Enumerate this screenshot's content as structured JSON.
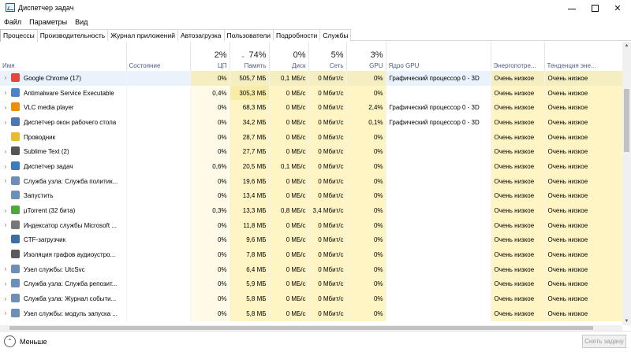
{
  "window": {
    "title": "Диспетчер задач",
    "minimize": "—",
    "maximize": "☐",
    "close": "✕"
  },
  "menu": [
    {
      "label": "Файл"
    },
    {
      "label": "Параметры"
    },
    {
      "label": "Вид"
    }
  ],
  "tabs": [
    {
      "label": "Процессы",
      "active": true
    },
    {
      "label": "Производительность"
    },
    {
      "label": "Журнал приложений"
    },
    {
      "label": "Автозагрузка"
    },
    {
      "label": "Пользователи"
    },
    {
      "label": "Подробности"
    },
    {
      "label": "Службы"
    }
  ],
  "columns": {
    "name": "Имя",
    "status": "Состояние",
    "cpu": {
      "pct": "2%",
      "label": "ЦП"
    },
    "memory": {
      "pct": "74%",
      "label": "Память"
    },
    "disk": {
      "pct": "0%",
      "label": "Диск"
    },
    "network": {
      "pct": "5%",
      "label": "Сеть"
    },
    "gpu": {
      "pct": "3%",
      "label": "GPU"
    },
    "gpu_engine": "Ядро GPU",
    "power": "Энергопотре...",
    "power_trend": "Тенденция эне..."
  },
  "processes": [
    {
      "name": "Google Chrome (17)",
      "icon": "chrome-icon",
      "color": "#e8453c",
      "cpu": "0%",
      "mem": "505,7 МБ",
      "disk": "0,1 МБ/с",
      "net": "0 Мбит/с",
      "gpu": "0%",
      "gpu_engine": "Графический процессор 0 - 3D",
      "power": "Очень низкое",
      "trend": "Очень низкое"
    },
    {
      "name": "Antimalware Service Executable",
      "icon": "shield-icon",
      "color": "#4f83c7",
      "cpu": "0,4%",
      "mem": "305,3 МБ",
      "disk": "0 МБ/с",
      "net": "0 Мбит/с",
      "gpu": "0%",
      "gpu_engine": "",
      "power": "Очень низкое",
      "trend": "Очень низкое"
    },
    {
      "name": "VLC media player",
      "icon": "vlc-icon",
      "color": "#f08c00",
      "cpu": "0%",
      "mem": "68,3 МБ",
      "disk": "0 МБ/с",
      "net": "0 Мбит/с",
      "gpu": "2,4%",
      "gpu_engine": "Графический процессор 0 - 3D",
      "power": "Очень низкое",
      "trend": "Очень низкое"
    },
    {
      "name": "Диспетчер окон рабочего стола",
      "icon": "dwm-icon",
      "color": "#4a78b5",
      "cpu": "0%",
      "mem": "34,2 МБ",
      "disk": "0 МБ/с",
      "net": "0 Мбит/с",
      "gpu": "0,1%",
      "gpu_engine": "Графический процессор 0 - 3D",
      "power": "Очень низкое",
      "trend": "Очень низкое"
    },
    {
      "name": "Проводник",
      "icon": "folder-icon",
      "color": "#e8b931",
      "cpu": "0%",
      "mem": "28,7 МБ",
      "disk": "0 МБ/с",
      "net": "0 Мбит/с",
      "gpu": "0%",
      "gpu_engine": "",
      "power": "Очень низкое",
      "trend": "Очень низкое"
    },
    {
      "name": "Sublime Text (2)",
      "icon": "sublime-icon",
      "color": "#555555",
      "cpu": "0%",
      "mem": "27,7 МБ",
      "disk": "0 МБ/с",
      "net": "0 Мбит/с",
      "gpu": "0%",
      "gpu_engine": "",
      "power": "Очень низкое",
      "trend": "Очень низкое"
    },
    {
      "name": "Диспетчер задач",
      "icon": "taskmgr-icon",
      "color": "#3b7bbf",
      "cpu": "0,6%",
      "mem": "20,5 МБ",
      "disk": "0,1 МБ/с",
      "net": "0 Мбит/с",
      "gpu": "0%",
      "gpu_engine": "",
      "power": "Очень низкое",
      "trend": "Очень низкое"
    },
    {
      "name": "Служба узла: Служба политик...",
      "icon": "gear-icon",
      "color": "#6b8fb8",
      "cpu": "0%",
      "mem": "19,6 МБ",
      "disk": "0 МБ/с",
      "net": "0 Мбит/с",
      "gpu": "0%",
      "gpu_engine": "",
      "power": "Очень низкое",
      "trend": "Очень низкое"
    },
    {
      "name": "Запустить",
      "icon": "gear-icon",
      "color": "#6b8fb8",
      "cpu": "0%",
      "mem": "13,4 МБ",
      "disk": "0 МБ/с",
      "net": "0 Мбит/с",
      "gpu": "0%",
      "gpu_engine": "",
      "power": "Очень низкое",
      "trend": "Очень низкое"
    },
    {
      "name": "µTorrent (32 бита)",
      "icon": "utorrent-icon",
      "color": "#4fa83a",
      "cpu": "0,3%",
      "mem": "13,3 МБ",
      "disk": "0,8 МБ/с",
      "net": "3,4 Мбит/с",
      "gpu": "0%",
      "gpu_engine": "",
      "power": "Очень низкое",
      "trend": "Очень низкое"
    },
    {
      "name": "Индексатор службы Microsoft ...",
      "icon": "search-indexer-icon",
      "color": "#777777",
      "cpu": "0%",
      "mem": "11,8 МБ",
      "disk": "0 МБ/с",
      "net": "0 Мбит/с",
      "gpu": "0%",
      "gpu_engine": "",
      "power": "Очень низкое",
      "trend": "Очень низкое"
    },
    {
      "name": "CTF-загрузчик",
      "icon": "ctf-icon",
      "color": "#3a6ea5",
      "cpu": "0%",
      "mem": "9,6 МБ",
      "disk": "0 МБ/с",
      "net": "0 Мбит/с",
      "gpu": "0%",
      "gpu_engine": "",
      "power": "Очень низкое",
      "trend": "Очень низкое"
    },
    {
      "name": "Изоляция графов аудиоустро...",
      "icon": "audio-icon",
      "color": "#5a5a5a",
      "cpu": "0%",
      "mem": "7,8 МБ",
      "disk": "0 МБ/с",
      "net": "0 Мбит/с",
      "gpu": "0%",
      "gpu_engine": "",
      "power": "Очень низкое",
      "trend": "Очень низкое"
    },
    {
      "name": "Узел службы: UtcSvc",
      "icon": "gear-icon",
      "color": "#6b8fb8",
      "cpu": "0%",
      "mem": "6,4 МБ",
      "disk": "0 МБ/с",
      "net": "0 Мбит/с",
      "gpu": "0%",
      "gpu_engine": "",
      "power": "Очень низкое",
      "trend": "Очень низкое"
    },
    {
      "name": "Служба узла: Служба репозит...",
      "icon": "gear-icon",
      "color": "#6b8fb8",
      "cpu": "0%",
      "mem": "5,9 МБ",
      "disk": "0 МБ/с",
      "net": "0 Мбит/с",
      "gpu": "0%",
      "gpu_engine": "",
      "power": "Очень низкое",
      "trend": "Очень низкое"
    },
    {
      "name": "Служба узла: Журнал событи...",
      "icon": "gear-icon",
      "color": "#6b8fb8",
      "cpu": "0%",
      "mem": "5,8 МБ",
      "disk": "0 МБ/с",
      "net": "0 Мбит/с",
      "gpu": "0%",
      "gpu_engine": "",
      "power": "Очень низкое",
      "trend": "Очень низкое"
    },
    {
      "name": "Узел службы: модуль запуска ...",
      "icon": "gear-icon",
      "color": "#6b8fb8",
      "cpu": "0%",
      "mem": "5,8 МБ",
      "disk": "0 МБ/с",
      "net": "0 Мбит/с",
      "gpu": "0%",
      "gpu_engine": "",
      "power": "Очень низкое",
      "trend": "Очень низкое"
    }
  ],
  "footer": {
    "fewer_details": "Меньше",
    "end_task": "Снять задачу"
  }
}
